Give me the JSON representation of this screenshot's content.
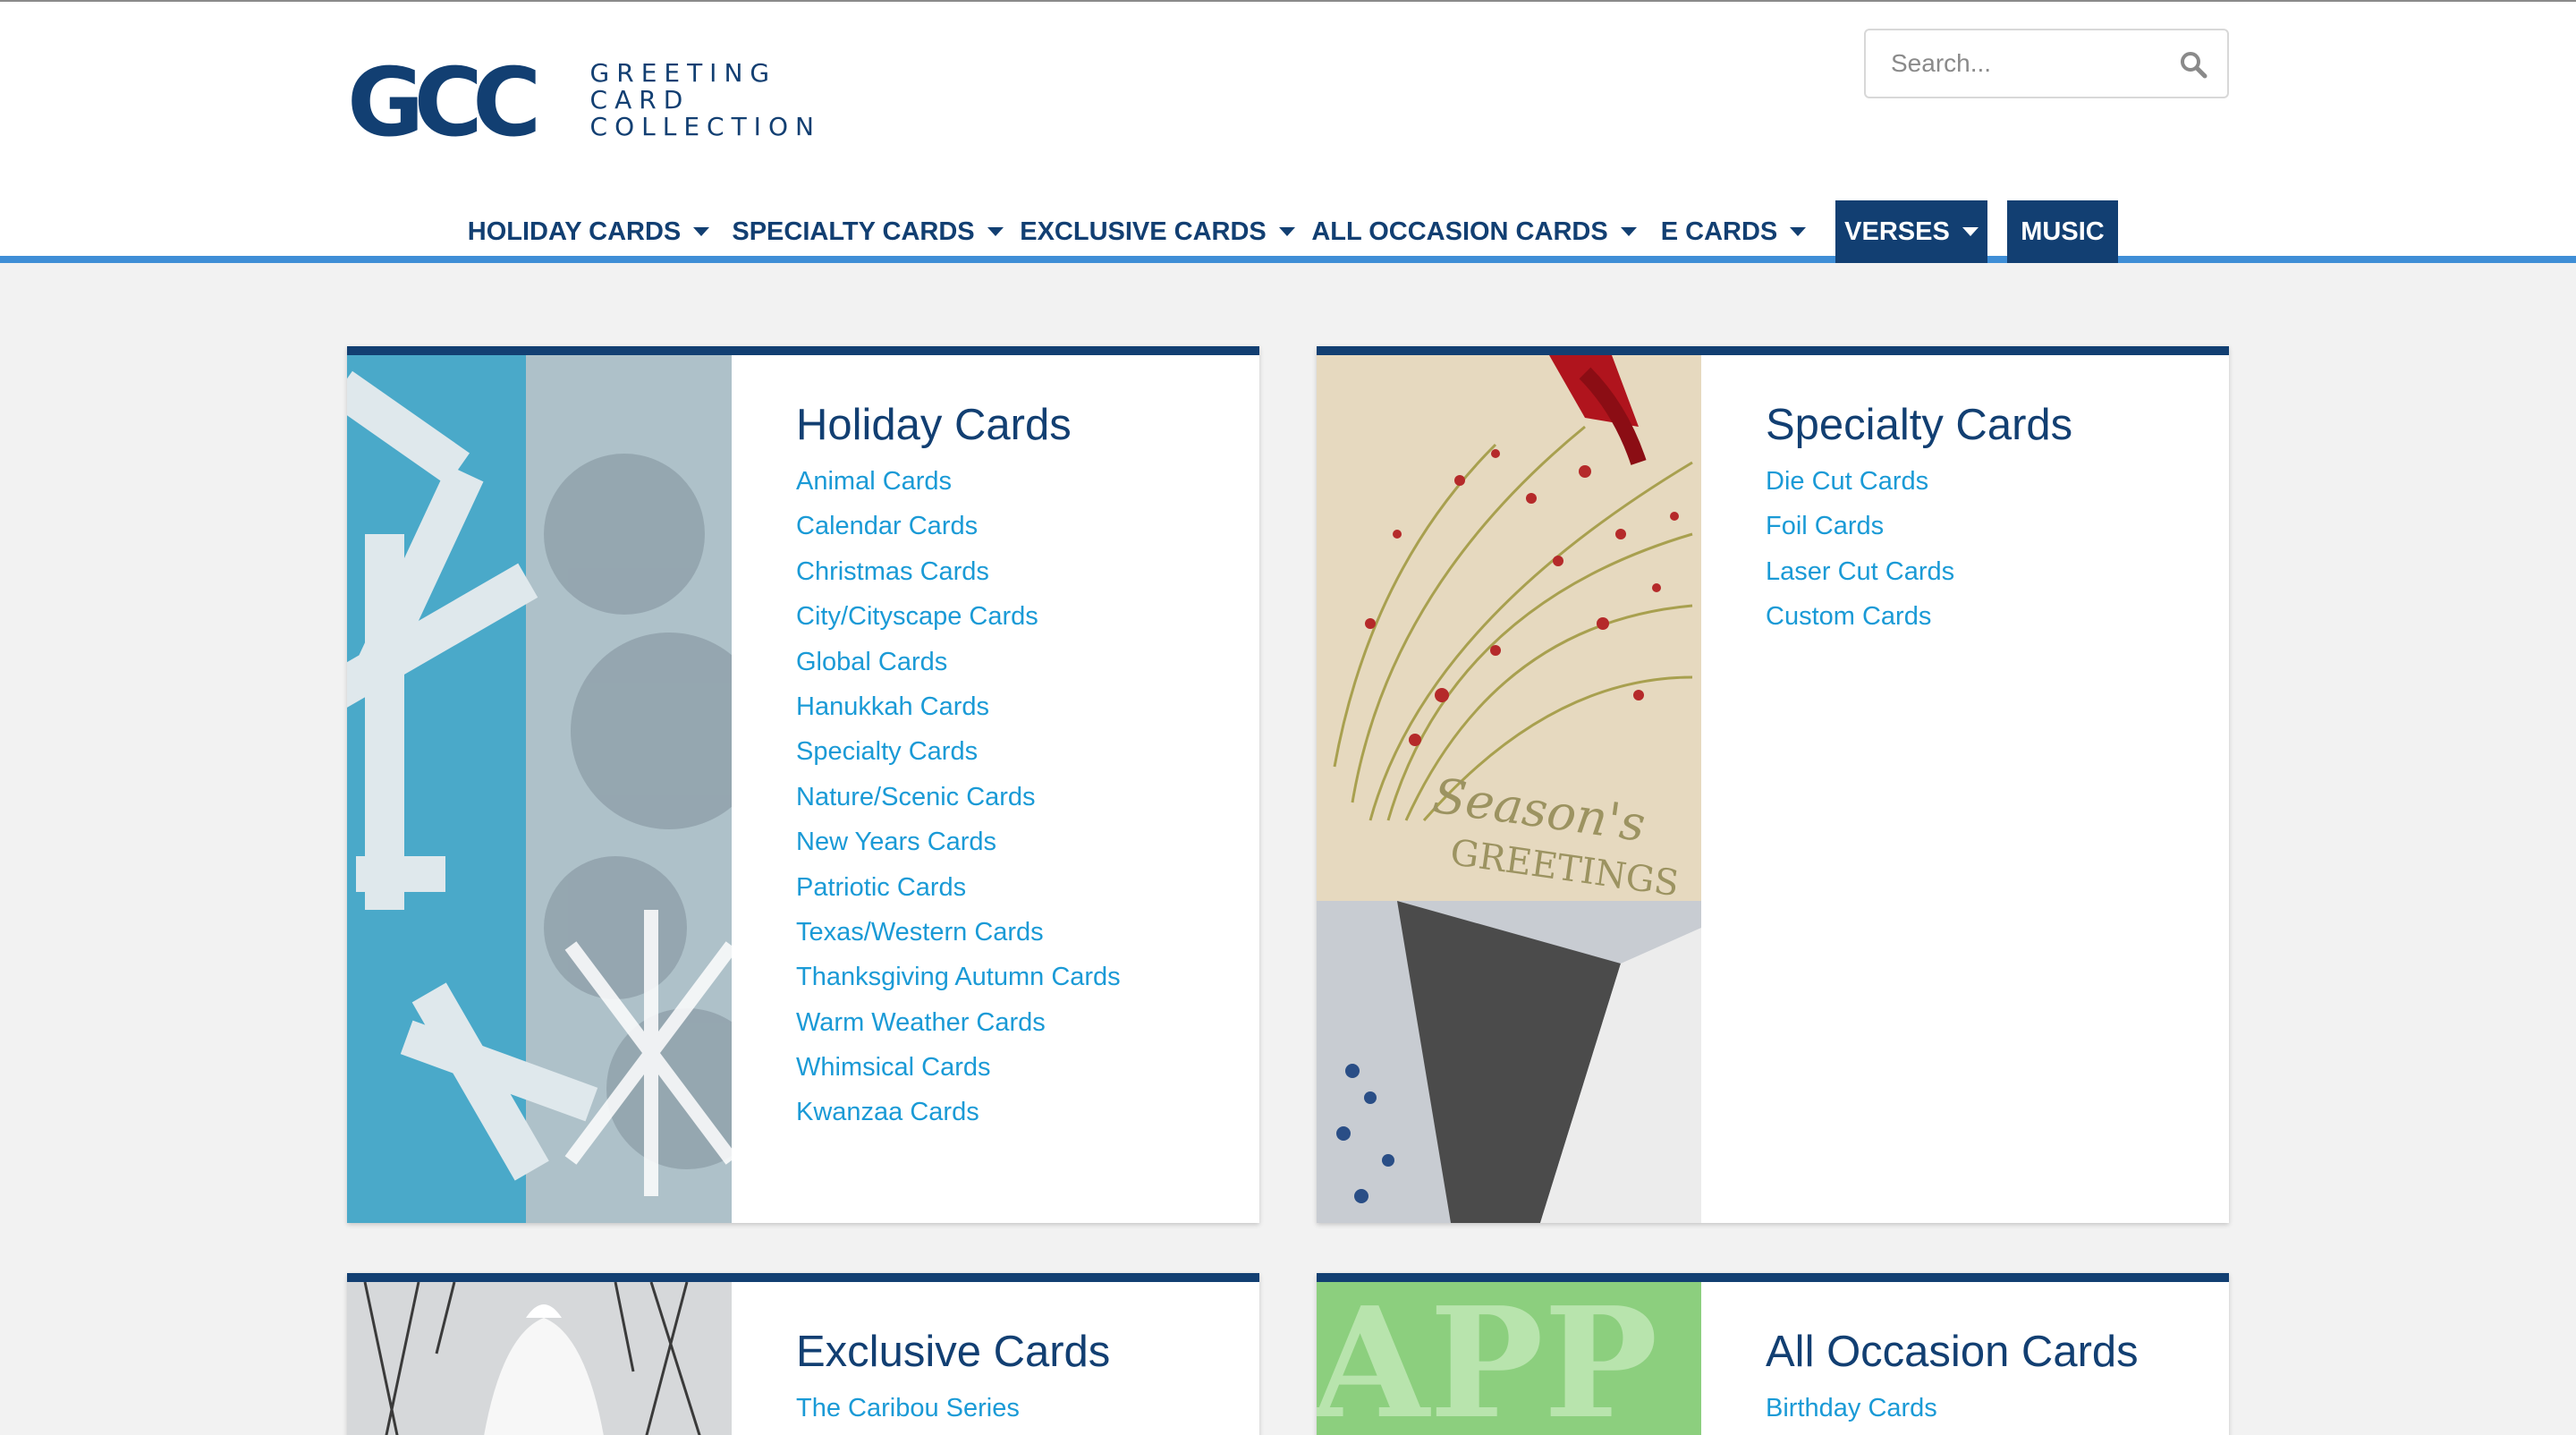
{
  "logo": {
    "mark": "GCC",
    "line1": "Greeting Card",
    "line2": "Collection"
  },
  "search": {
    "placeholder": "Search..."
  },
  "nav": [
    {
      "label": "HOLIDAY CARDS",
      "dropdown": true
    },
    {
      "label": "SPECIALTY CARDS",
      "dropdown": true
    },
    {
      "label": "EXCLUSIVE CARDS",
      "dropdown": true
    },
    {
      "label": "ALL OCCASION CARDS",
      "dropdown": true
    },
    {
      "label": "E CARDS",
      "dropdown": true
    },
    {
      "label": "VERSES",
      "dropdown": true,
      "active": true
    },
    {
      "label": "MUSIC",
      "dropdown": false,
      "active": true
    }
  ],
  "sections": [
    {
      "title": "Holiday Cards",
      "links": [
        "Animal Cards",
        "Calendar Cards",
        "Christmas Cards",
        "City/Cityscape Cards",
        "Global Cards",
        "Hanukkah Cards",
        "Specialty Cards",
        "Nature/Scenic Cards",
        "New Years Cards",
        "Patriotic Cards",
        "Texas/Western Cards",
        "Thanksgiving Autumn Cards",
        "Warm Weather Cards",
        "Whimsical Cards",
        "Kwanzaa Cards"
      ]
    },
    {
      "title": "Specialty Cards",
      "links": [
        "Die Cut Cards",
        "Foil Cards",
        "Laser Cut Cards",
        "Custom Cards"
      ],
      "image_text": {
        "line1": "Season's",
        "line2": "GREETINGS"
      }
    },
    {
      "title": "Exclusive Cards",
      "links": [
        "The Caribou Series"
      ]
    },
    {
      "title": "All Occasion Cards",
      "links": [
        "Birthday Cards"
      ],
      "image_text": "APP"
    }
  ],
  "colors": {
    "brand_navy": "#123f72",
    "link_blue": "#1a9ad6",
    "nav_rule": "#3f8ed6",
    "page_bg": "#f2f2f2"
  }
}
